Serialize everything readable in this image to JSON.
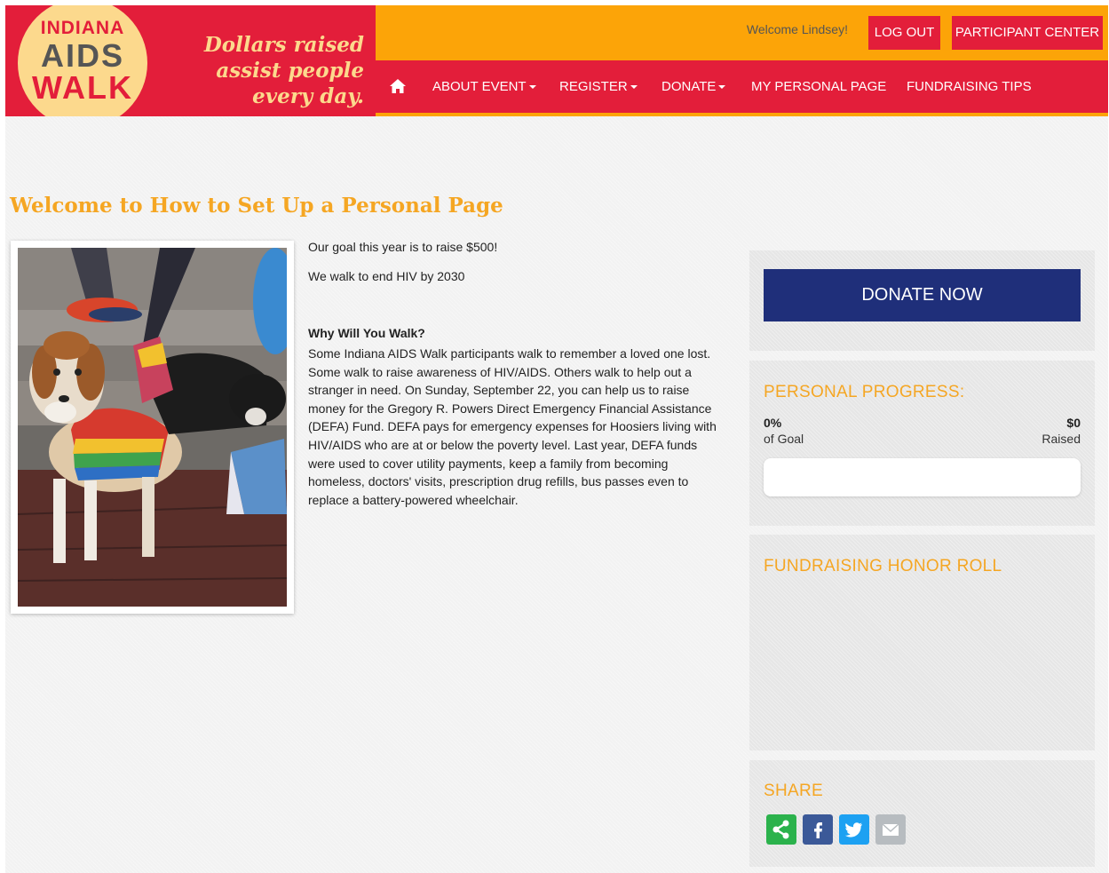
{
  "brand": {
    "logo_line1": "INDIANA",
    "logo_line2": "AIDS",
    "logo_line3": "WALK",
    "tagline": "Dollars raised assist people every day."
  },
  "topbar": {
    "welcome": "Welcome Lindsey!",
    "logout_label": "LOG OUT",
    "participant_center_label": "PARTICIPANT CENTER"
  },
  "nav": {
    "home_icon": "home-icon",
    "items": [
      {
        "label": "ABOUT EVENT",
        "dropdown": true
      },
      {
        "label": "REGISTER",
        "dropdown": true
      },
      {
        "label": "DONATE",
        "dropdown": true
      },
      {
        "label": "MY PERSONAL PAGE",
        "dropdown": false
      },
      {
        "label": "FUNDRAISING TIPS",
        "dropdown": false
      }
    ]
  },
  "main": {
    "title": "Welcome to How to Set Up a Personal Page",
    "goal_text": "Our goal this year is to raise $500!",
    "tagline_text": "We walk to end HIV by 2030",
    "why_heading": "Why Will You Walk?",
    "why_body": "Some Indiana AIDS Walk participants walk to remember a loved one lost. Some walk to raise awareness of HIV/AIDS. Others walk to help out a stranger in need. On Sunday, September 22, you can help us to raise money for the Gregory R. Powers Direct Emergency Financial Assistance (DEFA) Fund. DEFA pays for emergency expenses for Hoosiers living with HIV/AIDS who are at or below the poverty level. Last year, DEFA funds were used to cover utility payments, keep a family from becoming homeless, doctors' visits, prescription drug refills, bus passes even to replace a battery-powered wheelchair."
  },
  "sidebar": {
    "donate_label": "DONATE NOW",
    "progress": {
      "title": "PERSONAL PROGRESS:",
      "percent": "0%",
      "percent_label": "of Goal",
      "amount": "$0",
      "amount_label": "Raised",
      "fill_fraction": 0
    },
    "honor_roll_title": "FUNDRAISING HONOR ROLL",
    "share": {
      "title": "SHARE",
      "buttons": [
        {
          "icon": "share-icon",
          "color": "#2bb24c"
        },
        {
          "icon": "facebook-icon",
          "color": "#3b5998"
        },
        {
          "icon": "twitter-icon",
          "color": "#1da1f2"
        },
        {
          "icon": "email-icon",
          "color": "#b7bcc0"
        }
      ]
    }
  },
  "colors": {
    "red": "#e31e3a",
    "orange": "#fca408",
    "gold": "#f5a623",
    "navy": "#1f2f7a",
    "cream": "#fcd98d"
  }
}
